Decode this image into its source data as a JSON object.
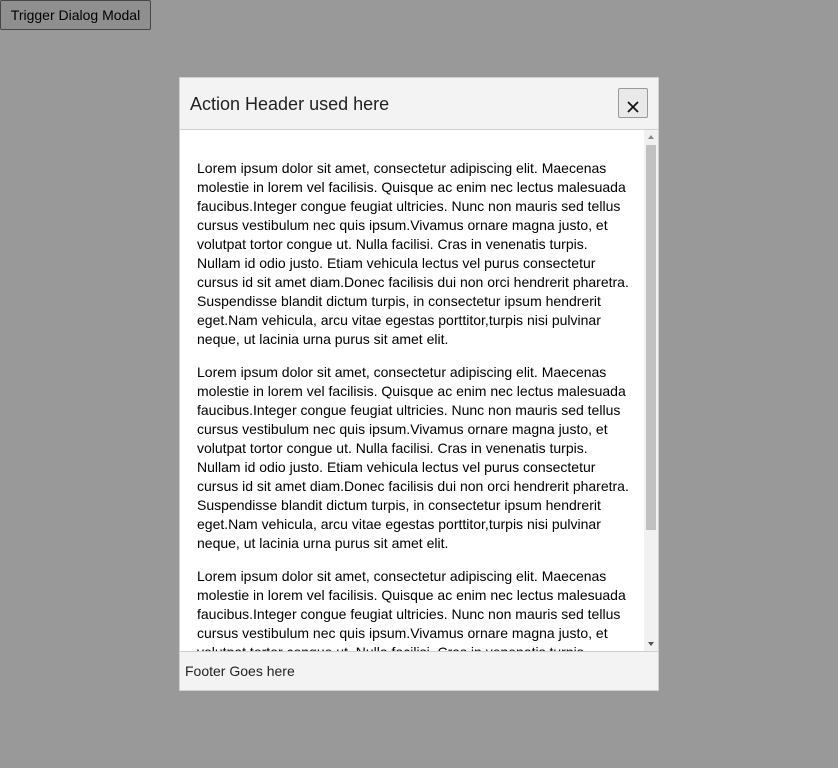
{
  "page": {
    "trigger_label": "Trigger Dialog Modal"
  },
  "modal": {
    "title": "Action Header used here",
    "close_icon": "close-icon",
    "paragraphs": [
      "Lorem ipsum dolor sit amet, consectetur adipiscing elit. Maecenas molestie in lorem vel facilisis. Quisque ac enim nec lectus malesuada faucibus.Integer congue feugiat ultricies. Nunc non mauris sed tellus cursus vestibulum nec quis ipsum.Vivamus ornare magna justo, et volutpat tortor congue ut. Nulla facilisi. Cras in venenatis turpis. Nullam id odio justo. Etiam vehicula lectus vel purus consectetur cursus id sit amet diam.Donec facilisis dui non orci hendrerit pharetra. Suspendisse blandit dictum turpis, in consectetur ipsum hendrerit eget.Nam vehicula, arcu vitae egestas porttitor,turpis nisi pulvinar neque, ut lacinia urna purus sit amet elit.",
      "Lorem ipsum dolor sit amet, consectetur adipiscing elit. Maecenas molestie in lorem vel facilisis. Quisque ac enim nec lectus malesuada faucibus.Integer congue feugiat ultricies. Nunc non mauris sed tellus cursus vestibulum nec quis ipsum.Vivamus ornare magna justo, et volutpat tortor congue ut. Nulla facilisi. Cras in venenatis turpis. Nullam id odio justo. Etiam vehicula lectus vel purus consectetur cursus id sit amet diam.Donec facilisis dui non orci hendrerit pharetra. Suspendisse blandit dictum turpis, in consectetur ipsum hendrerit eget.Nam vehicula, arcu vitae egestas porttitor,turpis nisi pulvinar neque, ut lacinia urna purus sit amet elit.",
      "Lorem ipsum dolor sit amet, consectetur adipiscing elit. Maecenas molestie in lorem vel facilisis. Quisque ac enim nec lectus malesuada faucibus.Integer congue feugiat ultricies. Nunc non mauris sed tellus cursus vestibulum nec quis ipsum.Vivamus ornare magna justo, et volutpat tortor congue ut. Nulla facilisi. Cras in venenatis turpis. Nullam id odio justo. Etiam vehicula lectus vel purus consectetur cursus id sit amet diam.Donec facilisis dui non orci hendrerit pharetra. Suspendisse blandit dictum turpis, in consectetur ipsum hendrerit eget.Nam vehicula, arcu vitae egestas porttitor,turpis nisi pulvinar neque, ut lacinia urna purus sit amet elit."
    ],
    "footer": "Footer Goes here"
  }
}
